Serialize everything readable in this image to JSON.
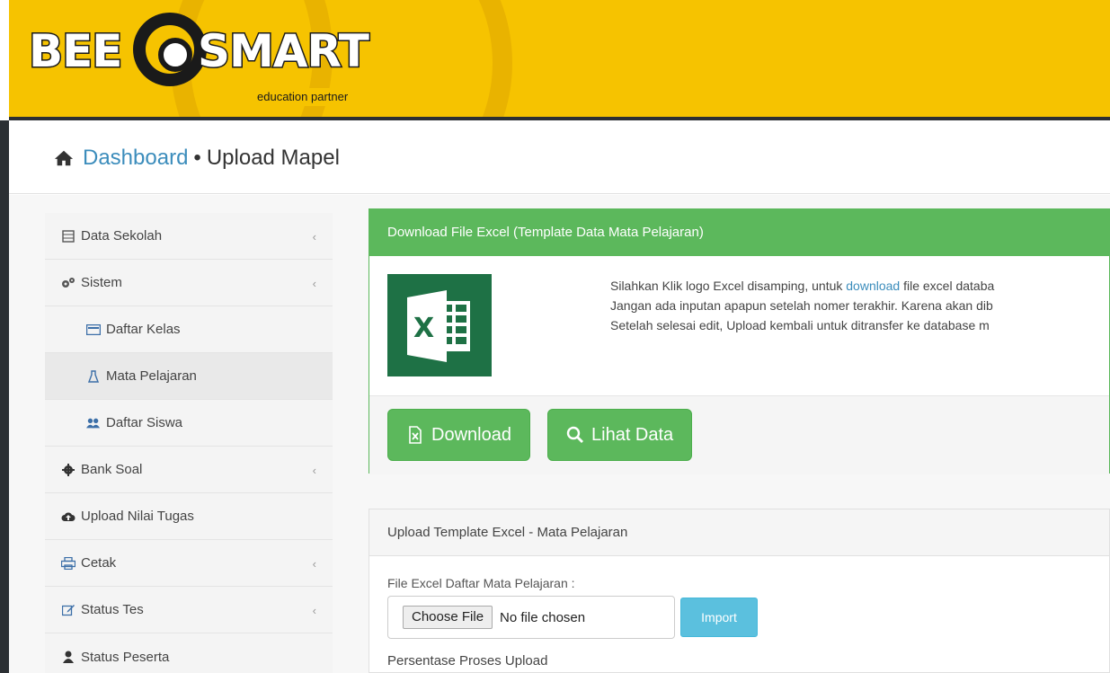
{
  "header": {
    "logo_bee": "BEE",
    "logo_smart": "SMART",
    "logo_tagline": "education partner",
    "color": "#f6c300"
  },
  "breadcrumb": {
    "home_icon": "home-icon",
    "root": "Dashboard",
    "separator": "•",
    "current": "Upload Mapel"
  },
  "sidebar": {
    "items": [
      {
        "label": "Data Sekolah",
        "icon": "table-icon",
        "chevron": "‹"
      },
      {
        "label": "Sistem",
        "icon": "cogs-icon",
        "chevron": "‹"
      },
      {
        "label": "Daftar Kelas",
        "icon": "list-icon"
      },
      {
        "label": "Mata Pelajaran",
        "icon": "flask-icon"
      },
      {
        "label": "Daftar Siswa",
        "icon": "users-icon"
      },
      {
        "label": "Bank Soal",
        "icon": "gear-icon",
        "chevron": "‹"
      },
      {
        "label": "Upload Nilai Tugas",
        "icon": "cloud-upload-icon"
      },
      {
        "label": "Cetak",
        "icon": "print-icon",
        "chevron": "‹"
      },
      {
        "label": "Status Tes",
        "icon": "edit-icon",
        "chevron": "‹"
      },
      {
        "label": "Status Peserta",
        "icon": "user-icon"
      }
    ]
  },
  "download_panel": {
    "title": "Download File Excel (Template Data Mata Pelajaran)",
    "line1_pre": "Silahkan Klik logo Excel disamping, untuk ",
    "line1_link": "download",
    "line1_post": " file excel databa",
    "line2": "Jangan ada inputan apapun setelah nomer terakhir. Karena akan dib",
    "line3": "Setelah selesai edit, Upload kembali untuk ditransfer ke database m",
    "download_label": "Download",
    "lihat_label": "Lihat Data",
    "excel_icon": "excel-icon"
  },
  "upload_panel": {
    "title": "Upload Template Excel - Mata Pelajaran",
    "field_label": "File Excel Daftar Mata Pelajaran :",
    "choose_label": "Choose File",
    "no_file": "No file chosen",
    "import_label": "Import",
    "progress_label": "Persentase Proses Upload"
  }
}
